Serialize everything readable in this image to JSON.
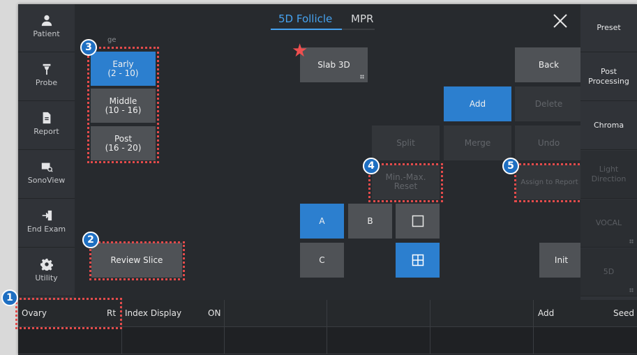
{
  "sidebar": {
    "items": [
      {
        "label": "Patient",
        "icon": "person-icon"
      },
      {
        "label": "Probe",
        "icon": "probe-icon"
      },
      {
        "label": "Report",
        "icon": "document-icon"
      },
      {
        "label": "SonoView",
        "icon": "sonoview-icon"
      },
      {
        "label": "End Exam",
        "icon": "exit-icon"
      },
      {
        "label": "Utility",
        "icon": "gear-icon"
      }
    ]
  },
  "rightbar": {
    "items": [
      {
        "label": "Preset",
        "enabled": true
      },
      {
        "label": "Post Processing",
        "enabled": true
      },
      {
        "label": "Chroma",
        "enabled": true
      },
      {
        "label": "Light Direction",
        "enabled": false
      },
      {
        "label": "VOCAL",
        "enabled": false
      },
      {
        "label": "5D",
        "enabled": false
      }
    ]
  },
  "tabs": [
    {
      "label": "5D Follicle",
      "active": true
    },
    {
      "label": "MPR",
      "active": false
    }
  ],
  "stage": {
    "label": "ge",
    "early": "Early\n(2 - 10)",
    "middle": "Middle\n(10 - 16)",
    "post": "Post\n(16 - 20)"
  },
  "buttons": {
    "slab3d": "Slab 3D",
    "back": "Back",
    "add": "Add",
    "delete": "Delete",
    "split": "Split",
    "merge": "Merge",
    "undo": "Undo",
    "minmax_reset": "Min.-Max.\nReset",
    "assign_report": "Assign to Report",
    "review_slice": "Review Slice",
    "a": "A",
    "b": "B",
    "c": "C",
    "init": "Init"
  },
  "badges": [
    "1",
    "2",
    "3",
    "4",
    "5"
  ],
  "bottom_bar": {
    "ovary_label": "Ovary",
    "ovary_value": "Rt",
    "index_display_label": "Index Display",
    "index_display_value": "ON",
    "add_label": "Add",
    "seed_label": "Seed"
  },
  "colors": {
    "accent_blue": "#2c7fcf",
    "tab_blue": "#46a2ef",
    "highlight_red": "#e44b4b",
    "star_red": "#ef4f4f"
  }
}
